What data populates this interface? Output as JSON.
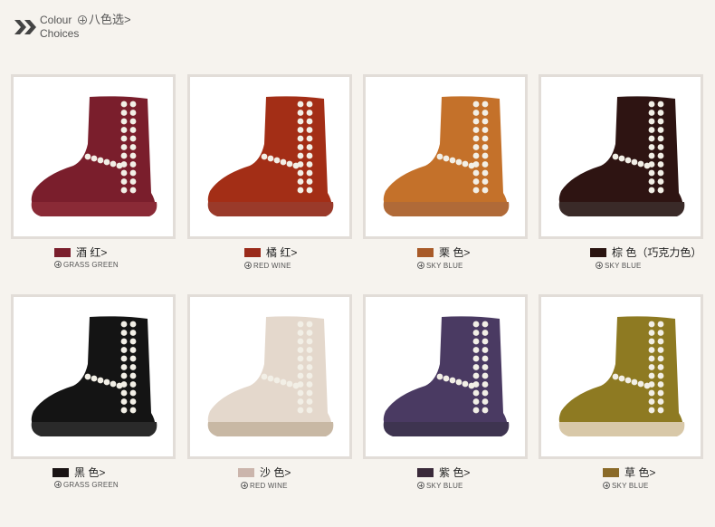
{
  "header": {
    "title_en_line1": "Colour",
    "title_en_line2": "Choices",
    "title_cn": "八色选>"
  },
  "products": [
    {
      "name": "酒  红>",
      "sub": "GRASS GREEN",
      "color": "#7a1e2c",
      "sole": "#8a2a36",
      "swatch": "#7a1e2c"
    },
    {
      "name": "橘  红>",
      "sub": "RED WINE",
      "color": "#a32e16",
      "sole": "#9a3a2a",
      "swatch": "#9a2a1a"
    },
    {
      "name": "栗  色>",
      "sub": "SKY BLUE",
      "color": "#c4712a",
      "sole": "#b06a38",
      "swatch": "#a85a28"
    },
    {
      "name": "棕  色（巧克力色）",
      "sub": "SKY BLUE",
      "color": "#2e1412",
      "sole": "#3a2a28",
      "swatch": "#2a1410"
    },
    {
      "name": "黑  色>",
      "sub": "GRASS GREEN",
      "color": "#141414",
      "sole": "#2a2a2a",
      "swatch": "#1a1414"
    },
    {
      "name": "沙  色>",
      "sub": "RED WINE",
      "color": "#e4d8cc",
      "sole": "#c8b8a4",
      "swatch": "#cbb5ac"
    },
    {
      "name": "紫  色>",
      "sub": "SKY BLUE",
      "color": "#4a3a62",
      "sole": "#3e3450",
      "swatch": "#3a2a3a"
    },
    {
      "name": "草  色>",
      "sub": "SKY BLUE",
      "color": "#8e7a22",
      "sole": "#d8c8a8",
      "swatch": "#8a6a28"
    }
  ]
}
